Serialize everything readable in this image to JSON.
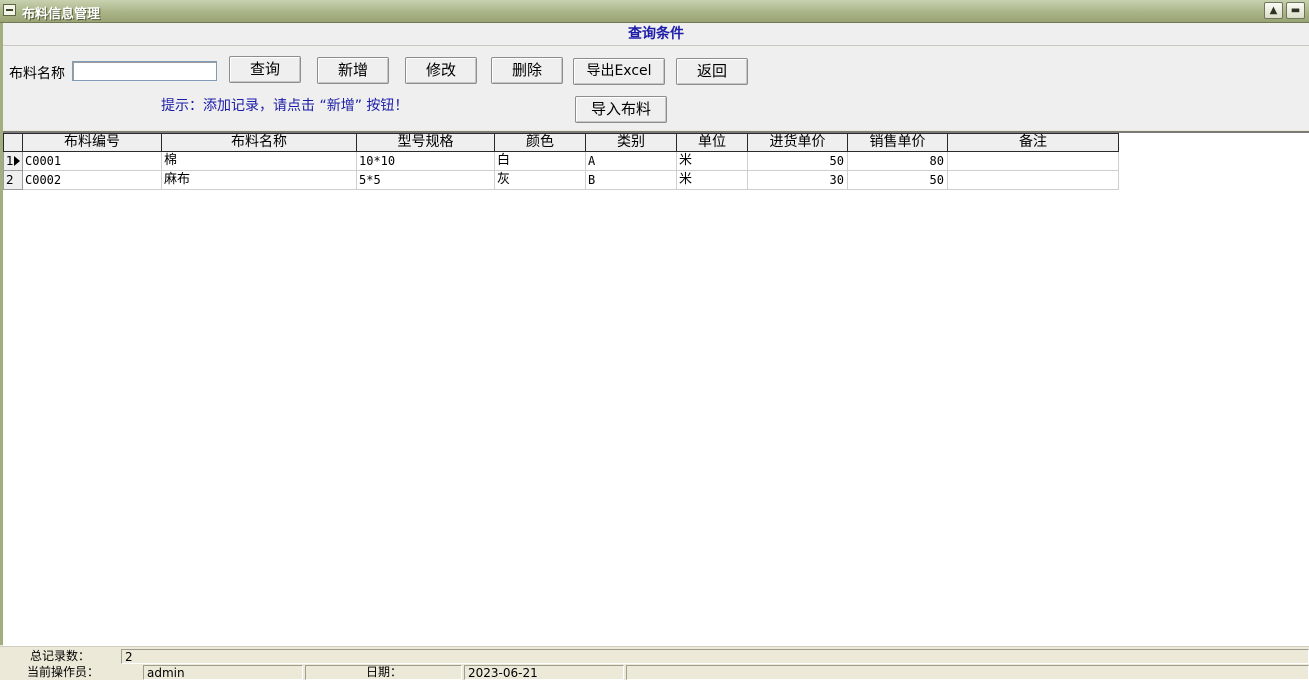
{
  "window": {
    "title": "布料信息管理",
    "restore_label": "▲",
    "minimize_label": "▬"
  },
  "conditions": {
    "header": "查询条件",
    "name_label": "布料名称",
    "name_value": "",
    "hint": "提示：添加记录，请点击 “新增” 按钮！"
  },
  "buttons": {
    "query": "查询",
    "add": "新增",
    "edit": "修改",
    "delete": "删除",
    "export": "导出Excel",
    "back": "返回",
    "import": "导入布料"
  },
  "table": {
    "headers": [
      "布料编号",
      "布料名称",
      "型号规格",
      "颜色",
      "类别",
      "单位",
      "进货单价",
      "销售单价",
      "备注"
    ],
    "rows": [
      {
        "index": "1",
        "code": "C0001",
        "name": "棉",
        "spec": "10*10",
        "color": "白",
        "category": "A",
        "unit": "米",
        "purchase_price": "50",
        "sale_price": "80",
        "note": ""
      },
      {
        "index": "2",
        "code": "C0002",
        "name": "麻布",
        "spec": "5*5",
        "color": "灰",
        "category": "B",
        "unit": "米",
        "purchase_price": "30",
        "sale_price": "50",
        "note": ""
      }
    ]
  },
  "status": {
    "total_label": "总记录数：",
    "total_value": "2",
    "operator_label": "当前操作员：",
    "operator_value": "admin",
    "date_label": "日期：",
    "date_value": "2023-06-21"
  }
}
